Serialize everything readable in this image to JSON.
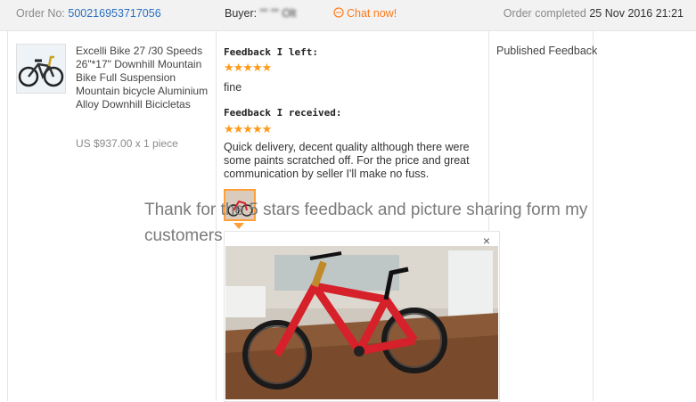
{
  "order": {
    "label": "Order No:",
    "number": "500216953717056"
  },
  "buyer": {
    "label": "Buyer:",
    "name": "\"\" \"\" Olt"
  },
  "chat": {
    "label": "Chat now!"
  },
  "completed": {
    "label": "Order completed",
    "date": "25 Nov 2016 21:21"
  },
  "product": {
    "title": "Excelli Bike 27 /30 Speeds 26\"*17\" Downhill Mountain Bike Full Suspension Mountain bicycle Aluminium Alloy Downhill Bicicletas",
    "price": "US $937.00 x 1 piece",
    "thumb_icon": "bicycle-image"
  },
  "feedback_left": {
    "label": "Feedback I left:",
    "stars": "★★★★★",
    "text": "fine"
  },
  "feedback_received": {
    "label": "Feedback I received:",
    "stars": "★★★★★",
    "text": "Quick delivery, decent quality although there were some paints scratched off. For the price and great communication by seller I'll make no fuss."
  },
  "status": "Published Feedback",
  "overlay_text": "Thank for the 5 stars feedback and picture sharing form my customers",
  "popup": {
    "close": "×"
  },
  "colors": {
    "accent": "#ff7a1a",
    "link": "#2a6fc0",
    "star": "#ff9a1a"
  }
}
